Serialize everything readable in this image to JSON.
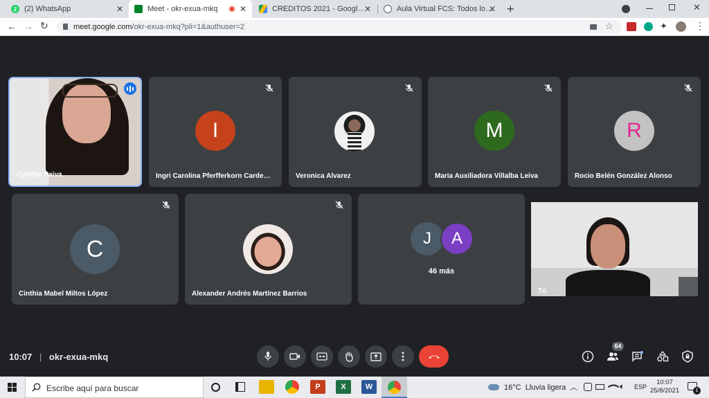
{
  "browser": {
    "tabs": [
      {
        "title": "(2) WhatsApp",
        "active": false
      },
      {
        "title": "Meet - okr-exua-mkq",
        "active": true
      },
      {
        "title": "CREDITOS 2021 - Google Drive",
        "active": false
      },
      {
        "title": "Aula Virtual FCS: Todos los cursos",
        "active": false
      }
    ],
    "whatsapp_badge": "2",
    "url_host": "meet.google.com",
    "url_path": "/okr-exua-mkq?pli=1&authuser=2"
  },
  "meet": {
    "participants": [
      {
        "name": "Cynthia Paiva",
        "initial": "",
        "speaking": true
      },
      {
        "name": "Ingri Carolina Pferfferkorn Carde…",
        "initial": "I",
        "color": "#c5421a"
      },
      {
        "name": "Veronica Alvarez",
        "initial": ""
      },
      {
        "name": "Maria Auxiliadora Villalba Leiva",
        "initial": "M",
        "color": "#2e6a1e"
      },
      {
        "name": "Rocio Belén González Alonso",
        "initial": "R",
        "color": "#c2c2c2",
        "text_color": "#e52592"
      },
      {
        "name": "Cinthia Mabel Miltos López",
        "initial": "C",
        "color": "#4a5a66"
      },
      {
        "name": "Alexander Andrés Martínez Barrios",
        "initial": ""
      },
      {
        "name": "Tú",
        "initial": ""
      }
    ],
    "more": {
      "initials": [
        "J",
        "A"
      ],
      "label": "46 más"
    },
    "time": "10:07",
    "meeting_code": "okr-exua-mkq",
    "people_count": "64"
  },
  "taskbar": {
    "search_placeholder": "Escribe aquí para buscar",
    "weather": "16°C  Lluvia ligera",
    "lang": "ESP",
    "clock_time": "10:07",
    "clock_date": "25/8/2021",
    "notification_count": "1"
  }
}
